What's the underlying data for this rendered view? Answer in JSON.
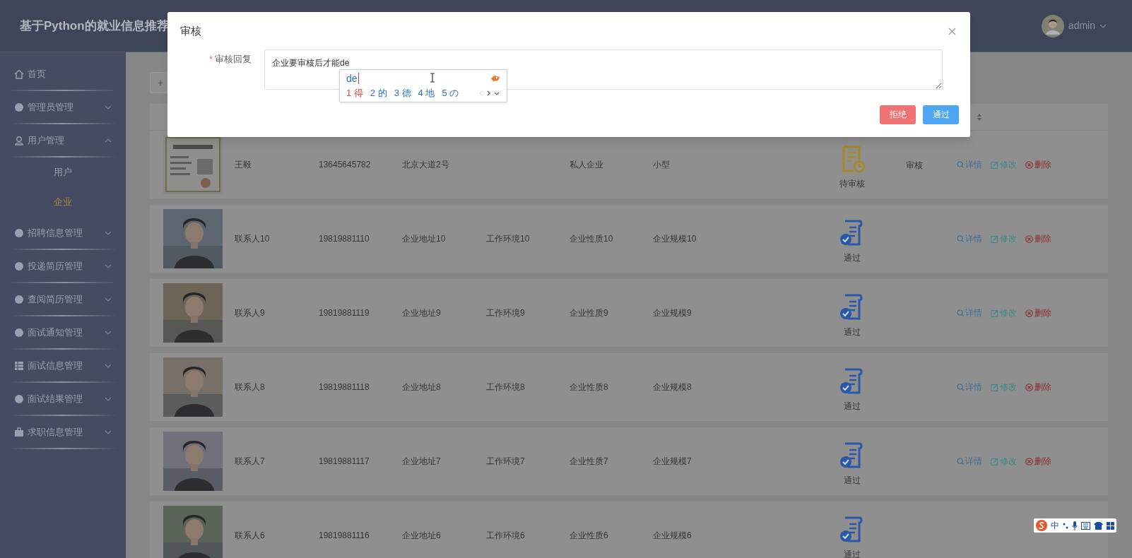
{
  "header": {
    "title": "基于Python的就业信息推荐",
    "user": "admin"
  },
  "sidebar": {
    "items": [
      {
        "label": "首页",
        "kind": "home"
      },
      {
        "label": "管理员管理",
        "kind": "dot",
        "expanded": false
      },
      {
        "label": "用户管理",
        "kind": "user",
        "expanded": true,
        "children": [
          {
            "label": "用户",
            "selected": false
          },
          {
            "label": "企业",
            "selected": true
          }
        ]
      },
      {
        "label": "招聘信息管理",
        "kind": "dot",
        "expanded": false
      },
      {
        "label": "投递简历管理",
        "kind": "dot",
        "expanded": false
      },
      {
        "label": "查阅简历管理",
        "kind": "dot",
        "expanded": false
      },
      {
        "label": "面试通知管理",
        "kind": "dot",
        "expanded": false
      },
      {
        "label": "面试信息管理",
        "kind": "grid",
        "expanded": false
      },
      {
        "label": "面试结果管理",
        "kind": "dot",
        "expanded": false
      },
      {
        "label": "求职信息管理",
        "kind": "bag",
        "expanded": false
      }
    ]
  },
  "toolbar": {
    "add_button": "+"
  },
  "table": {
    "rows": [
      {
        "name": "王毅",
        "phone": "13645645782",
        "address": "北京大道2号",
        "nature": "私人企业",
        "scale": "小型",
        "status": {
          "label": "待审核",
          "kind": "pending"
        },
        "review": "审核",
        "actions": [
          "详情",
          "修改",
          "删除"
        ]
      },
      {
        "name": "联系人10",
        "phone": "19819881110",
        "address": "企业地址10",
        "environment": "工作环境10",
        "nature": "企业性质10",
        "scale": "企业规模10",
        "status": {
          "label": "通过",
          "kind": "approved"
        },
        "actions": [
          "详情",
          "修改",
          "删除"
        ]
      },
      {
        "name": "联系人9",
        "phone": "19819881119",
        "address": "企业地址9",
        "environment": "工作环境9",
        "nature": "企业性质9",
        "scale": "企业规模9",
        "status": {
          "label": "通过",
          "kind": "approved"
        },
        "actions": [
          "详情",
          "修改",
          "删除"
        ]
      },
      {
        "name": "联系人8",
        "phone": "19819881118",
        "address": "企业地址8",
        "environment": "工作环境8",
        "nature": "企业性质8",
        "scale": "企业规模8",
        "status": {
          "label": "通过",
          "kind": "approved"
        },
        "actions": [
          "详情",
          "修改",
          "删除"
        ]
      },
      {
        "name": "联系人7",
        "phone": "19819881117",
        "address": "企业地址7",
        "environment": "工作环境7",
        "nature": "企业性质7",
        "scale": "企业规模7",
        "status": {
          "label": "通过",
          "kind": "approved"
        },
        "actions": [
          "详情",
          "修改",
          "删除"
        ]
      },
      {
        "name": "联系人6",
        "phone": "19819881116",
        "address": "企业地址6",
        "environment": "工作环境6",
        "nature": "企业性质6",
        "scale": "企业规模6",
        "status": {
          "label": "通过",
          "kind": "approved"
        }
      }
    ]
  },
  "dialog": {
    "title": "审核",
    "field_label": "审核回复",
    "required_mark": "*",
    "value": "企业要审核后才能de",
    "ime": {
      "input": "de",
      "candidates": [
        {
          "index": "1",
          "text": "得",
          "selected": true
        },
        {
          "index": "2",
          "text": "的",
          "selected": false
        },
        {
          "index": "3",
          "text": "德",
          "selected": false
        },
        {
          "index": "4",
          "text": "地",
          "selected": false
        },
        {
          "index": "5",
          "text": "の",
          "selected": false
        }
      ]
    },
    "buttons": [
      {
        "label": "拒绝",
        "kind": "danger"
      },
      {
        "label": "通过",
        "kind": "primary"
      }
    ]
  },
  "ime_toolbar": {
    "mode": "中"
  }
}
